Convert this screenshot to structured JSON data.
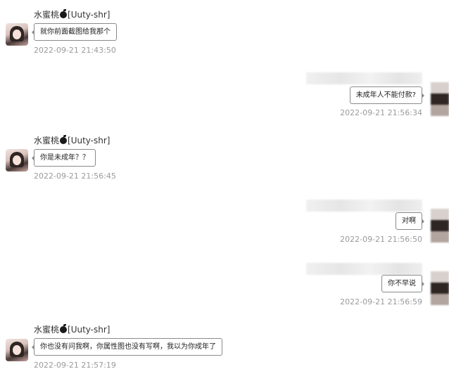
{
  "sender": {
    "name_prefix": "水蜜桃",
    "name_suffix": "[Uuty-shr]",
    "icon": "black-peach-emoji"
  },
  "messages": [
    {
      "side": "left",
      "text": "就你前面截图给我那个",
      "time": "2022-09-21 21:43:50"
    },
    {
      "side": "right",
      "text": "未成年人不能付款?",
      "time": "2022-09-21 21:56:34"
    },
    {
      "side": "left",
      "text": "你是未成年？？",
      "time": "2022-09-21 21:56:45"
    },
    {
      "side": "right",
      "text": "对啊",
      "time": "2022-09-21 21:56:50"
    },
    {
      "side": "right",
      "text": "你不早说",
      "time": "2022-09-21 21:56:59"
    },
    {
      "side": "left",
      "text": "你也没有问我啊，你属性图也没有写啊，我以为你成年了",
      "time": "2022-09-21 21:57:19"
    }
  ]
}
